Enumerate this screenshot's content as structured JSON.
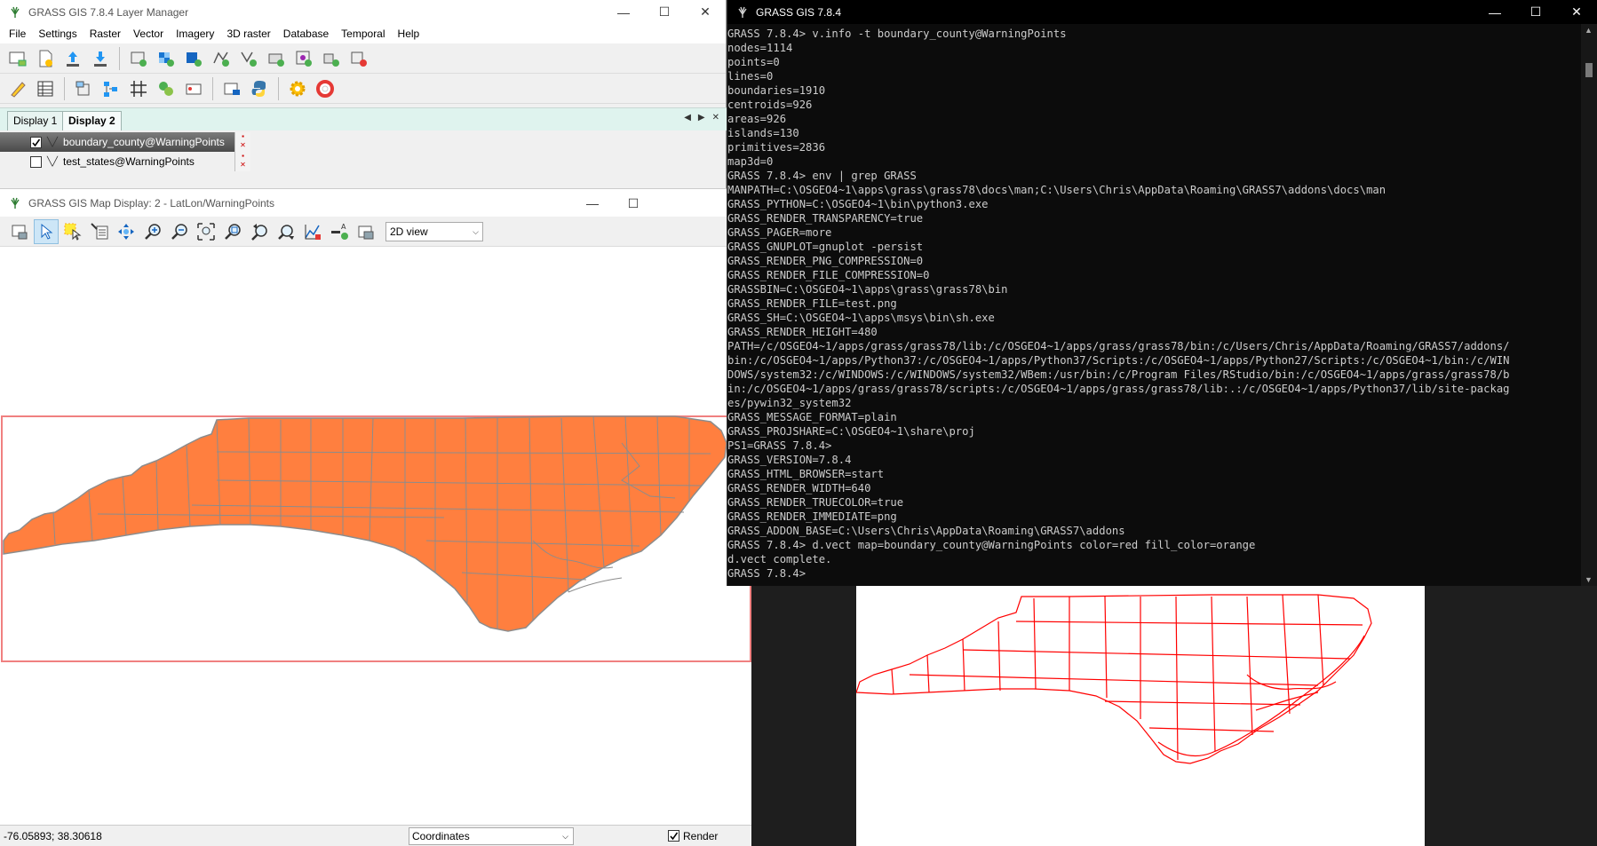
{
  "layer_manager": {
    "title": "GRASS GIS 7.8.4 Layer Manager",
    "window_controls": [
      "—",
      "☐",
      "✕"
    ],
    "menu": [
      "File",
      "Settings",
      "Raster",
      "Vector",
      "Imagery",
      "3D raster",
      "Database",
      "Temporal",
      "Help"
    ],
    "tabs": [
      "Display 1",
      "Display 2"
    ],
    "active_tab": "Display 2",
    "layers": [
      {
        "name": "boundary_county@WarningPoints",
        "checked": true
      },
      {
        "name": "test_states@WarningPoints",
        "checked": false
      }
    ]
  },
  "map_display": {
    "title": "GRASS GIS Map Display: 2 - LatLon/WarningPoints",
    "view_mode": "2D view",
    "coordinates": "-76.05893; 38.30618",
    "status_mode": "Coordinates",
    "render_label": "Render",
    "render_checked": true,
    "colors": {
      "fill": "#ff7f3f",
      "boundary": "#7d7d7d",
      "frame": "#f08080"
    }
  },
  "console": {
    "title": "GRASS GIS 7.8.4",
    "lines": [
      "GRASS 7.8.4> v.info -t boundary_county@WarningPoints",
      "nodes=1114",
      "points=0",
      "lines=0",
      "boundaries=1910",
      "centroids=926",
      "areas=926",
      "islands=130",
      "primitives=2836",
      "map3d=0",
      "GRASS 7.8.4> env | grep GRASS",
      "MANPATH=C:\\OSGEO4~1\\apps\\grass\\grass78\\docs\\man;C:\\Users\\Chris\\AppData\\Roaming\\GRASS7\\addons\\docs\\man",
      "GRASS_PYTHON=C:\\OSGEO4~1\\bin\\python3.exe",
      "GRASS_RENDER_TRANSPARENCY=true",
      "GRASS_PAGER=more",
      "GRASS_GNUPLOT=gnuplot -persist",
      "GRASS_RENDER_PNG_COMPRESSION=0",
      "GRASS_RENDER_FILE_COMPRESSION=0",
      "GRASSBIN=C:\\OSGEO4~1\\apps\\grass\\grass78\\bin",
      "GRASS_RENDER_FILE=test.png",
      "GRASS_SH=C:\\OSGEO4~1\\apps\\msys\\bin\\sh.exe",
      "GRASS_RENDER_HEIGHT=480",
      "PATH=/c/OSGEO4~1/apps/grass/grass78/lib:/c/OSGEO4~1/apps/grass/grass78/bin:/c/Users/Chris/AppData/Roaming/GRASS7/addons/",
      "bin:/c/OSGEO4~1/apps/Python37:/c/OSGEO4~1/apps/Python37/Scripts:/c/OSGEO4~1/apps/Python27/Scripts:/c/OSGEO4~1/bin:/c/WIN",
      "DOWS/system32:/c/WINDOWS:/c/WINDOWS/system32/WBem:/usr/bin:/c/Program Files/RStudio/bin:/c/OSGEO4~1/apps/grass/grass78/b",
      "in:/c/OSGEO4~1/apps/grass/grass78/scripts:/c/OSGEO4~1/apps/grass/grass78/lib:.:/c/OSGEO4~1/apps/Python37/lib/site-packag",
      "es/pywin32_system32",
      "GRASS_MESSAGE_FORMAT=plain",
      "GRASS_PROJSHARE=C:\\OSGEO4~1\\share\\proj",
      "PS1=GRASS 7.8.4>",
      "GRASS_VERSION=7.8.4",
      "GRASS_HTML_BROWSER=start",
      "GRASS_RENDER_WIDTH=640",
      "GRASS_RENDER_TRUECOLOR=true",
      "GRASS_RENDER_IMMEDIATE=png",
      "GRASS_ADDON_BASE=C:\\Users\\Chris\\AppData\\Roaming\\GRASS7\\addons",
      "GRASS 7.8.4> d.vect map=boundary_county@WarningPoints color=red fill_color=orange",
      "d.vect complete.",
      "GRASS 7.8.4>"
    ]
  },
  "render_output": {
    "colors": {
      "stroke": "#ff0000",
      "background": "#ffffff"
    }
  }
}
